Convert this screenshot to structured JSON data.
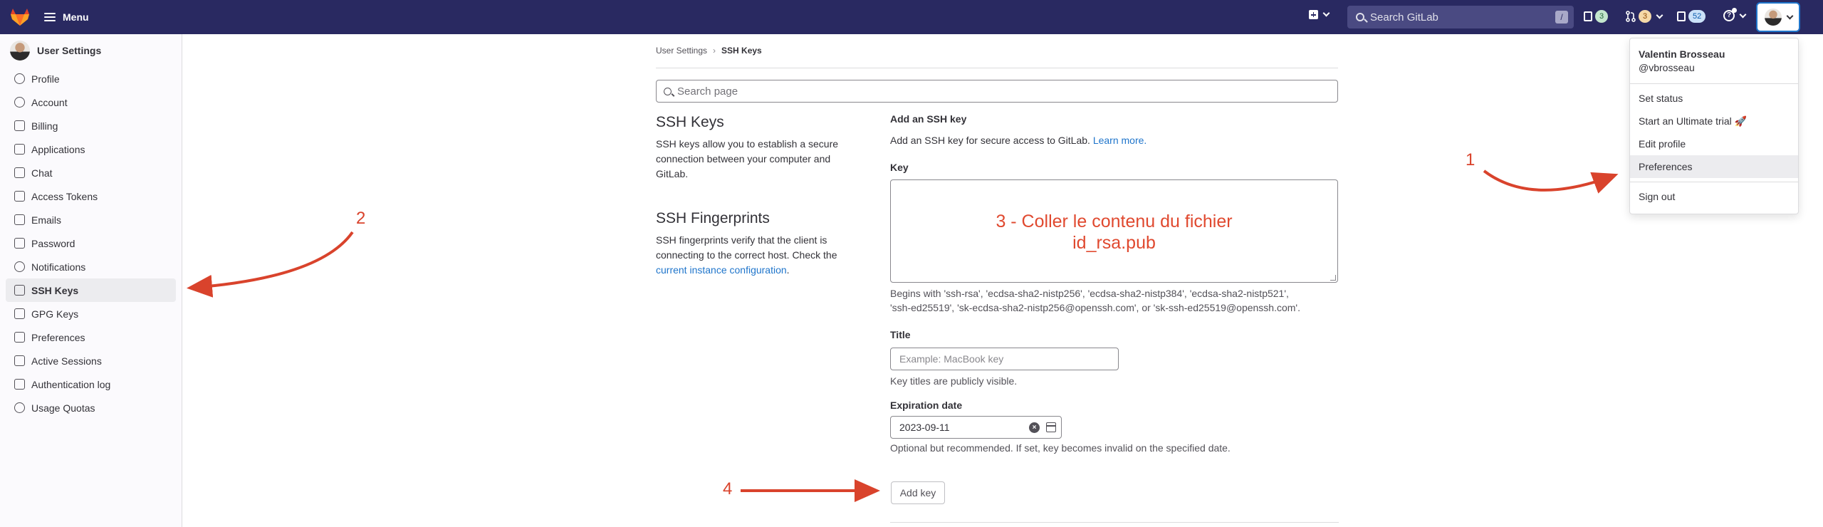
{
  "topbar": {
    "menu_label": "Menu",
    "search_placeholder": "Search GitLab",
    "search_shortcut": "/",
    "issues_count": "3",
    "mr_count": "3",
    "todos_count": "52",
    "help_glyph": "?"
  },
  "sidebar": {
    "title": "User Settings",
    "items": [
      {
        "label": "Profile",
        "icon": "profile-icon"
      },
      {
        "label": "Account",
        "icon": "account-icon"
      },
      {
        "label": "Billing",
        "icon": "billing-icon"
      },
      {
        "label": "Applications",
        "icon": "applications-icon"
      },
      {
        "label": "Chat",
        "icon": "chat-icon"
      },
      {
        "label": "Access Tokens",
        "icon": "token-icon"
      },
      {
        "label": "Emails",
        "icon": "mail-icon"
      },
      {
        "label": "Password",
        "icon": "lock-icon"
      },
      {
        "label": "Notifications",
        "icon": "bell-icon"
      },
      {
        "label": "SSH Keys",
        "icon": "key-icon"
      },
      {
        "label": "GPG Keys",
        "icon": "key-icon"
      },
      {
        "label": "Preferences",
        "icon": "preferences-icon"
      },
      {
        "label": "Active Sessions",
        "icon": "monitor-icon"
      },
      {
        "label": "Authentication log",
        "icon": "log-icon"
      },
      {
        "label": "Usage Quotas",
        "icon": "info-icon"
      }
    ]
  },
  "breadcrumb": {
    "parent": "User Settings",
    "separator": "›",
    "current": "SSH Keys"
  },
  "page_search": {
    "placeholder": "Search page"
  },
  "ssh_section": {
    "title": "SSH Keys",
    "description": "SSH keys allow you to establish a secure connection between your computer and GitLab."
  },
  "fingerprints_section": {
    "title": "SSH Fingerprints",
    "description": "SSH fingerprints verify that the client is connecting to the correct host. Check the",
    "link": "current instance configuration",
    "after_link": "."
  },
  "form": {
    "heading": "Add an SSH key",
    "intro": "Add an SSH key for secure access to GitLab.",
    "learn_more": "Learn more.",
    "key_label": "Key",
    "key_help_1": "Begins with 'ssh-rsa', 'ecdsa-sha2-nistp256', 'ecdsa-sha2-nistp384', 'ecdsa-sha2-nistp521',",
    "key_help_2": "'ssh-ed25519', 'sk-ecdsa-sha2-nistp256@openssh.com', or 'sk-ssh-ed25519@openssh.com'.",
    "title_label": "Title",
    "title_placeholder": "Example: MacBook key",
    "title_help": "Key titles are publicly visible.",
    "expiration_label": "Expiration date",
    "expiration_value": "2023-09-11",
    "expiration_help": "Optional but recommended. If set, key becomes invalid on the specified date.",
    "submit_label": "Add key"
  },
  "user_menu": {
    "name": "Valentin Brosseau",
    "username": "@vbrosseau",
    "items": [
      "Set status",
      "Start an Ultimate trial 🚀",
      "Edit profile",
      "Preferences",
      "Sign out"
    ]
  },
  "annotations": {
    "n1": "1",
    "n2": "2",
    "n3_line1": "3 - Coller le contenu du fichier",
    "n3_line2": "id_rsa.pub",
    "n4": "4",
    "color": "#d9432c"
  }
}
